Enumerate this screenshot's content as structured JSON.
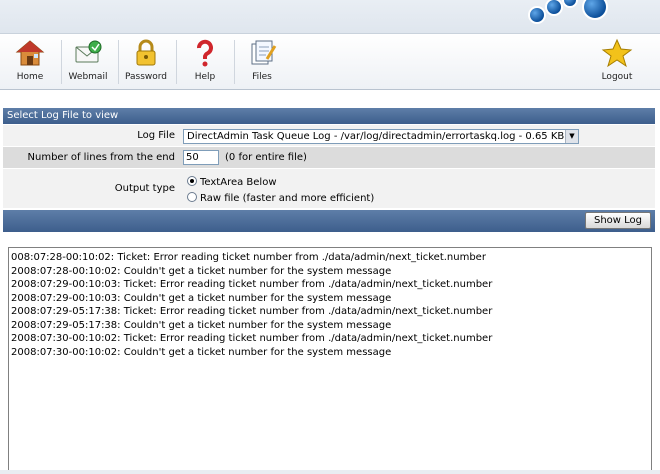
{
  "toolbar": {
    "items": [
      {
        "label": "Home",
        "icon": "house-icon"
      },
      {
        "label": "Webmail",
        "icon": "mail-icon"
      },
      {
        "label": "Password",
        "icon": "lock-icon"
      },
      {
        "label": "Help",
        "icon": "question-icon"
      },
      {
        "label": "Files",
        "icon": "files-icon"
      },
      {
        "label": "Logout",
        "icon": "star-icon"
      }
    ]
  },
  "panel": {
    "title": "Select Log File to view",
    "log_file_label": "Log File",
    "log_file_value": "DirectAdmin Task Queue Log - /var/log/directadmin/errortaskq.log - 0.65 KB",
    "lines_label": "Number of lines from the end",
    "lines_value": "50",
    "lines_hint": "(0 for entire file)",
    "output_label": "Output type",
    "output_options": [
      {
        "label": "TextArea Below",
        "selected": true
      },
      {
        "label": "Raw file (faster and more efficient)",
        "selected": false
      }
    ],
    "show_button": "Show Log"
  },
  "log": {
    "lines": [
      "008:07:28-00:10:02: Ticket: Error reading ticket number from ./data/admin/next_ticket.number",
      "2008:07:28-00:10:02: Couldn't get a ticket number for the system message",
      "2008:07:29-00:10:03: Ticket: Error reading ticket number from ./data/admin/next_ticket.number",
      "2008:07:29-00:10:03: Couldn't get a ticket number for the system message",
      "2008:07:29-05:17:38: Ticket: Error reading ticket number from ./data/admin/next_ticket.number",
      "2008:07:29-05:17:38: Couldn't get a ticket number for the system message",
      "2008:07:30-00:10:02: Ticket: Error reading ticket number from ./data/admin/next_ticket.number",
      "2008:07:30-00:10:02: Couldn't get a ticket number for the system message"
    ]
  },
  "colors": {
    "header_blue": "#3d5e8c",
    "accent_blue": "#0c4f9a"
  }
}
